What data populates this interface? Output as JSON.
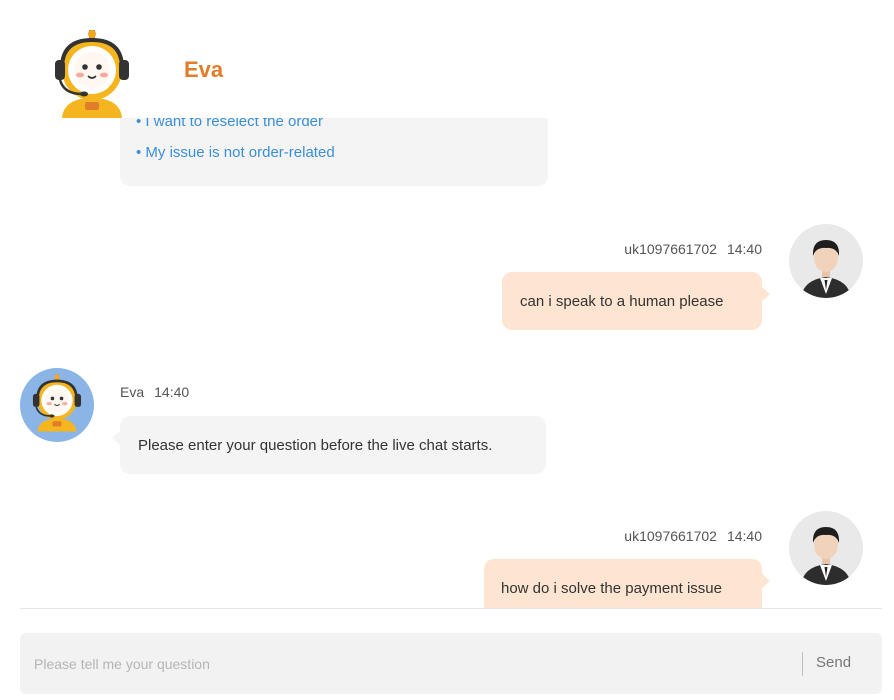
{
  "header": {
    "title": "Eva",
    "avatar_icon": "robot-headset-icon"
  },
  "messages": {
    "bot_options": {
      "items": [
        "• I want to reselect the order",
        "• My issue is not order-related"
      ]
    },
    "user_msg_1": {
      "sender": "uk1097661702",
      "time": "14:40",
      "text": "can i speak to a human please"
    },
    "bot_msg_1": {
      "sender": "Eva",
      "time": "14:40",
      "text": "Please enter your question before the live chat starts."
    },
    "user_msg_2": {
      "sender": "uk1097661702",
      "time": "14:40",
      "text": "how do i solve the payment issue"
    }
  },
  "input": {
    "placeholder": "Please tell me your question",
    "value": "",
    "send_label": "Send"
  },
  "colors": {
    "brand": "#E07D2A",
    "link": "#3a8fd6",
    "user_bubble": "#fde5d2",
    "bot_bubble": "#f4f4f4"
  }
}
